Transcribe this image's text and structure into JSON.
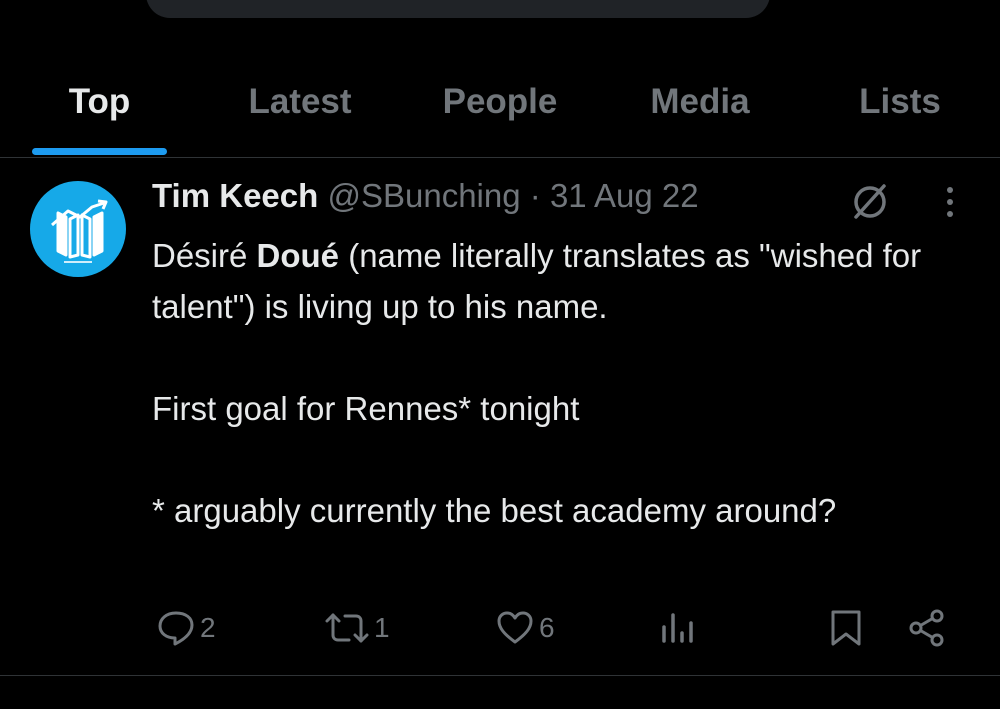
{
  "tabs": [
    {
      "label": "Top",
      "active": true
    },
    {
      "label": "Latest",
      "active": false
    },
    {
      "label": "People",
      "active": false
    },
    {
      "label": "Media",
      "active": false
    },
    {
      "label": "Lists",
      "active": false
    }
  ],
  "tweet": {
    "author_name": "Tim Keech",
    "handle": "@SBunching",
    "separator": "·",
    "date": "31 Aug 22",
    "text_part1": "Désiré ",
    "text_bold": "Doué",
    "text_part2": " (name literally translates as \"wished for talent\") is living up to his name.",
    "text_line2": "First goal for Rennes* tonight",
    "text_line3": "* arguably currently the best academy around?",
    "replies": "2",
    "reposts": "1",
    "likes": "6"
  },
  "icons": {
    "avatar": "avatar-logo",
    "grok": "grok-icon",
    "more": "more-vertical-icon",
    "reply": "reply-icon",
    "repost": "repost-icon",
    "like": "heart-icon",
    "views": "views-icon",
    "bookmark": "bookmark-icon",
    "share": "share-icon"
  },
  "colors": {
    "background": "#000000",
    "accent": "#1d9bf0",
    "text_primary": "#e7e9ea",
    "text_secondary": "#71767b",
    "divider": "#2f3336",
    "avatar_bg": "#16a9e8"
  }
}
